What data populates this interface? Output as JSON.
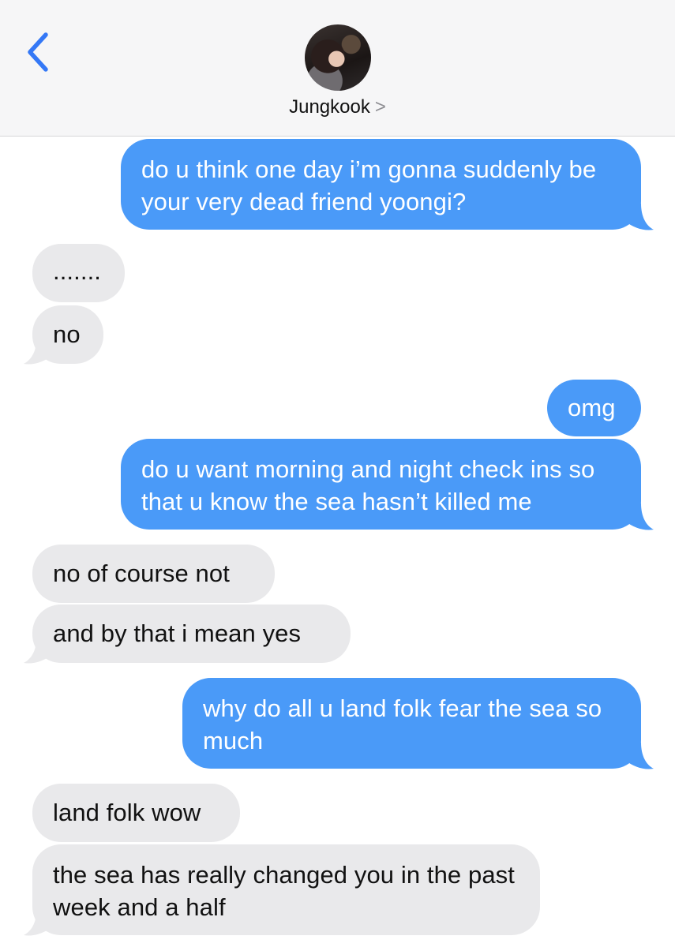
{
  "header": {
    "contact_name": "Jungkook",
    "contact_chevron": ">"
  },
  "messages": [
    {
      "from": "me",
      "text": "do u think one day i’m gonna suddenly be your very dead friend yoongi?"
    },
    {
      "from": "them",
      "text": "......."
    },
    {
      "from": "them",
      "text": "no"
    },
    {
      "from": "me",
      "text": "omg"
    },
    {
      "from": "me",
      "text": "do u want morning and night check ins so that u know the sea hasn’t killed me"
    },
    {
      "from": "them",
      "text": "no of course not"
    },
    {
      "from": "them",
      "text": "and by that i mean yes"
    },
    {
      "from": "me",
      "text": "why do all u land folk fear the sea so much"
    },
    {
      "from": "them",
      "text": "land folk wow"
    },
    {
      "from": "them",
      "text": "the sea has really changed you in the past week and a half"
    }
  ],
  "colors": {
    "sent_bubble": "#4a9af8",
    "received_bubble": "#e9e9eb",
    "accent": "#3478f6"
  }
}
